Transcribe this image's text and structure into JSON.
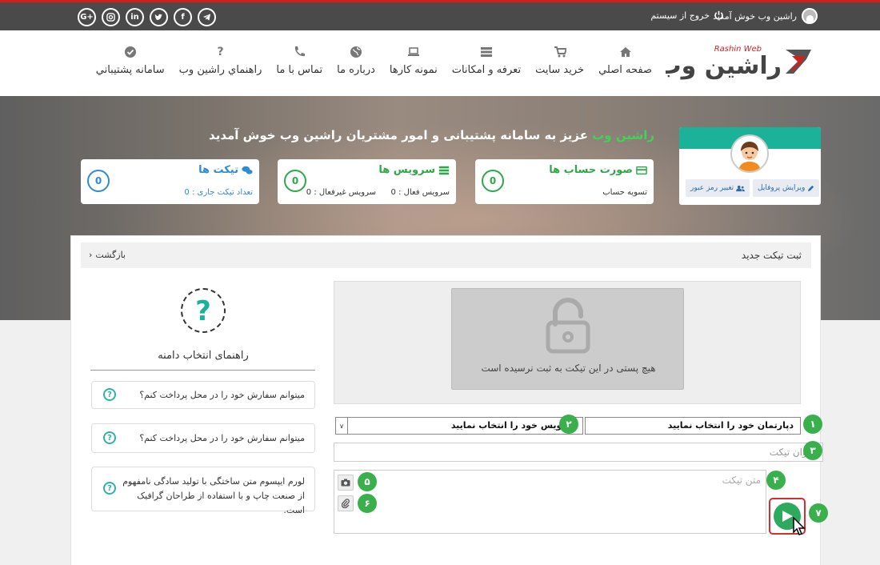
{
  "topbar": {
    "welcome": "راشین وب خوش آمدید",
    "logout": "خروج از سیستم",
    "social": [
      "G+",
      "instagram",
      "in",
      "twitter",
      "f",
      "telegram"
    ]
  },
  "nav": {
    "items": [
      {
        "label": "صفحه اصلي",
        "icon": "home-icon"
      },
      {
        "label": "خريد سايت",
        "icon": "cart-icon"
      },
      {
        "label": "تعرفه و امكانات",
        "icon": "server-icon"
      },
      {
        "label": "نمونه كارها",
        "icon": "laptop-icon"
      },
      {
        "label": "درباره ما",
        "icon": "globe-icon"
      },
      {
        "label": "تماس با ما",
        "icon": "phone-icon"
      },
      {
        "label": "راهنماي راشين وب",
        "icon": "question-icon"
      },
      {
        "label": "سامانه پشتيباني",
        "icon": "check-circle-icon"
      }
    ]
  },
  "logo": {
    "fa": "راشین وب",
    "en": "Rashin Web"
  },
  "hero": {
    "brand": "راشین وب",
    "welcome_rest": " عزیز به سامانه پشتیبانی و امور مشتریان راشین وب خوش آمدید"
  },
  "stats": {
    "invoices": {
      "title": "صورت حساب ها",
      "count": "0",
      "sub": "تسویه حساب"
    },
    "services": {
      "title": "سرویس ها",
      "count": "0",
      "active": "سرویس فعال : 0",
      "inactive": "سرویس غیرفعال : 0"
    },
    "tickets": {
      "title": "تیکت ها",
      "count": "0",
      "current": "تعداد تیکت جاری : 0"
    }
  },
  "profile": {
    "edit": "ویرایش پروفایل",
    "password": "تغییر رمز عبور"
  },
  "panel": {
    "title": "ثبت تیکت جدید",
    "back": "بازگشت",
    "empty_message": "هیچ پستی در این تیکت به ثبت نرسیده است",
    "department_select": "دپارتمان خود را انتخاب نمایید",
    "service_select": "سرویس خود را انتخاب نمایید",
    "title_placeholder": "عنوان تیکت",
    "text_placeholder": "متن تیکت",
    "steps": [
      "۱",
      "۲",
      "۳",
      "۴",
      "۵",
      "۶",
      "۷"
    ]
  },
  "guide": {
    "title": "راهنمای انتخاب دامنه",
    "faq": [
      "میتوانم سفارش خود را در محل پرداخت کنم؟",
      "میتوانم سفارش خود را در محل پرداخت کنم؟",
      "لورم ایپسوم متن ساختگی با تولید سادگی نامفهوم از صنعت چاپ و با استفاده از طراحان گرافیک است."
    ]
  },
  "colors": {
    "accent": "#1ab39a",
    "brand_red": "#d21e1e",
    "green": "#3ab04d",
    "blue": "#2e8bd8"
  }
}
